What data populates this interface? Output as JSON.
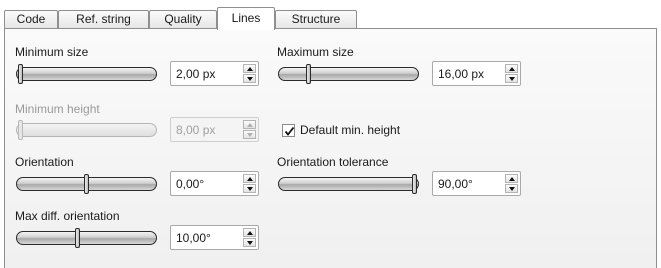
{
  "tabs": [
    {
      "label": "Code"
    },
    {
      "label": "Ref. string"
    },
    {
      "label": "Quality"
    },
    {
      "label": "Lines",
      "active": true
    },
    {
      "label": "Structure"
    }
  ],
  "fields": {
    "min_size": {
      "label": "Minimum size",
      "value": "2,00 px",
      "slider_level": 0.0
    },
    "max_size": {
      "label": "Maximum size",
      "value": "16,00 px",
      "slider_level": 0.2
    },
    "min_height": {
      "label": "Minimum height",
      "value": "8,00 px",
      "slider_level": 0.0,
      "disabled": true
    },
    "default_min_height": {
      "label": "Default min. height",
      "checked": true
    },
    "orientation": {
      "label": "Orientation",
      "value": "0,00°",
      "slider_level": 0.5
    },
    "orientation_tolerance": {
      "label": "Orientation tolerance",
      "value": "90,00°",
      "slider_level": 1.0
    },
    "max_diff_orientation": {
      "label": "Max diff. orientation",
      "value": "10,00°",
      "slider_level": 0.43
    }
  },
  "colors": {
    "border": "#8e8f8f",
    "panel": "#f3f3f3"
  }
}
